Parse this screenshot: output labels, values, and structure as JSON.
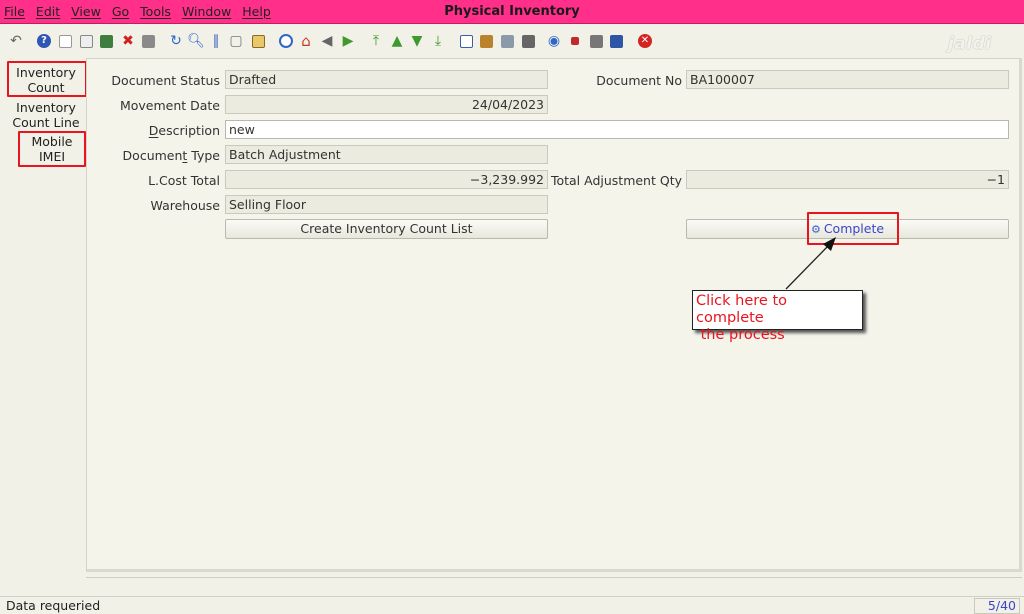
{
  "window": {
    "title": "Physical Inventory"
  },
  "menu": [
    "File",
    "Edit",
    "View",
    "Go",
    "Tools",
    "Window",
    "Help"
  ],
  "watermark": "jaldi",
  "tabs": {
    "inventory_count": "Inventory Count",
    "inventory_count_line": "Inventory Count Line",
    "mobile_imei": "Mobile IMEI"
  },
  "form": {
    "document_status": {
      "label": "Document Status",
      "value": "Drafted"
    },
    "document_no": {
      "label": "Document No",
      "value": "BA100007"
    },
    "movement_date": {
      "label": "Movement Date",
      "value": "24/04/2023"
    },
    "description": {
      "label_pre": "",
      "label_u": "D",
      "label_post": "escription",
      "value": "new"
    },
    "document_type": {
      "label_pre": "Documen",
      "label_u": "t",
      "label_post": " Type",
      "value": "Batch Adjustment"
    },
    "lcost_total": {
      "label": "L.Cost Total",
      "value": "−3,239.992"
    },
    "total_adjustment_qty": {
      "label": "Total Adjustment Qty",
      "value": "−1"
    },
    "warehouse": {
      "label": "Warehouse",
      "value": "Selling Floor"
    }
  },
  "buttons": {
    "create_inventory_count_list": "Create Inventory Count List",
    "complete": "Complete"
  },
  "callout": {
    "line1": "Click here to complete",
    "line2": " the process"
  },
  "status": {
    "message": "Data requeried",
    "page": "5/40"
  },
  "colors": {
    "titlebar": "#ff2f8a",
    "highlight": "#e8141f",
    "link": "#3a45c9"
  }
}
